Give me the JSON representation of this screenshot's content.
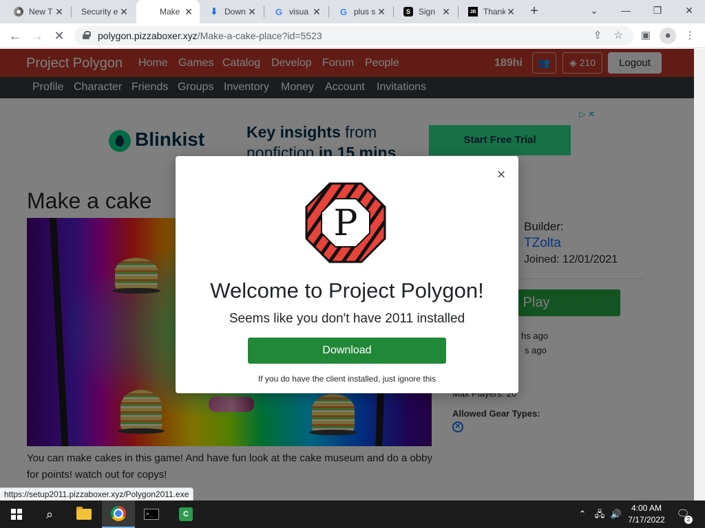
{
  "browser": {
    "tabs": [
      {
        "title": "New T",
        "icon": "chrome-icon"
      },
      {
        "title": "Security e",
        "icon": "security-icon"
      },
      {
        "title": "Make",
        "icon": "none",
        "active": true
      },
      {
        "title": "Down",
        "icon": "download-icon"
      },
      {
        "title": "visua",
        "icon": "google-icon"
      },
      {
        "title": "plus s",
        "icon": "google-icon"
      },
      {
        "title": "Sign",
        "icon": "sign-icon"
      },
      {
        "title": "Thank",
        "icon": "jb-icon"
      }
    ],
    "fav_jb": "JB",
    "fav_sign": "S",
    "fav_google": "G",
    "newtab_glyph": "+",
    "url_domain": "polygon.pizzaboxer.xyz",
    "url_path": "/Make-a-cake-place?id=5523",
    "status_link": "https://setup2011.pizzaboxer.xyz/Polygon2011.exe"
  },
  "nav": {
    "brand": "Project Polygon",
    "links": [
      "Home",
      "Games",
      "Catalog",
      "Develop",
      "Forum",
      "People"
    ],
    "username": "189hi",
    "currency": "210",
    "logout": "Logout",
    "sublinks": [
      "Profile",
      "Character",
      "Friends",
      "Groups",
      "Inventory",
      "Money",
      "Account",
      "Invitations"
    ]
  },
  "ad": {
    "brand": "Blinkist",
    "headline_bold1": "Key insights",
    "headline_normal1": " from",
    "headline_normal2": "nonfiction ",
    "headline_bold2": "in 15 mins",
    "cta": "Start Free Trial"
  },
  "game": {
    "title": "Make a cake",
    "description": "You can make cakes in this game! And have fun look at the cake museum and do a obby for points! watch out for copys!",
    "builder_label": "Builder:",
    "builder_name": "TZolta",
    "joined": "Joined: 12/01/2021",
    "play": "Play",
    "created_ago": "hs ago",
    "updated_ago": "s ago",
    "max_players": "Max Players: 20",
    "gear_label": "Allowed Gear Types:"
  },
  "modal": {
    "logo_letter": "P",
    "title": "Welcome to Project Polygon!",
    "subtitle": "Seems like you don't have 2011 installed",
    "download": "Download",
    "note": "If you do have the client installed, just ignore this"
  },
  "taskbar": {
    "time": "4:00 AM",
    "date": "7/17/2022",
    "notification_count": "2"
  }
}
